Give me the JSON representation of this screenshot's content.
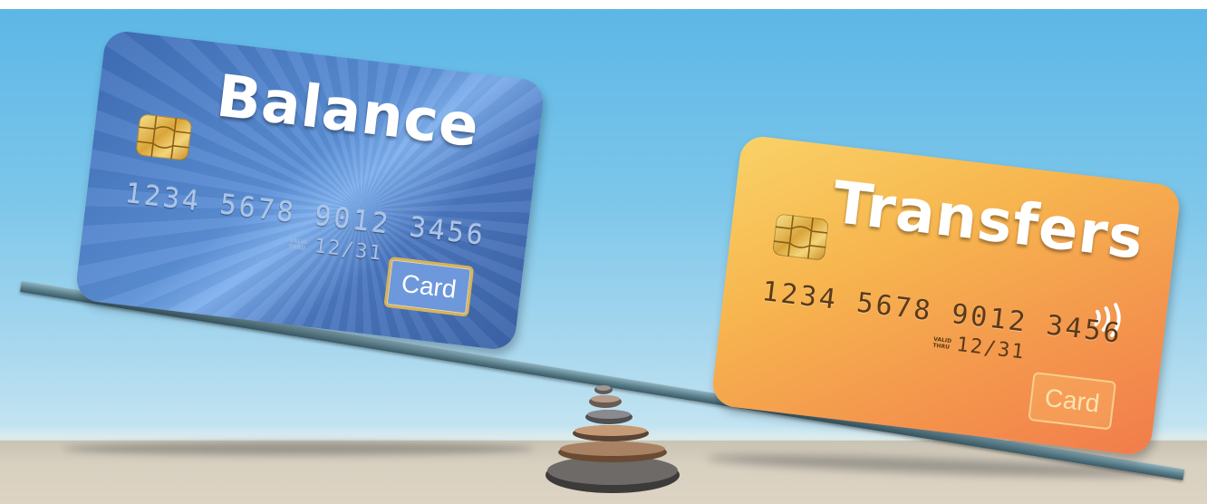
{
  "scene": {
    "colors": {
      "sky_top": "#5bb6e6",
      "sky_bottom": "#c7e6f2",
      "ground": "#d8d0c0",
      "plank": "#5a7f8c"
    }
  },
  "card_left": {
    "title": "Balance",
    "number": "1234 5678 9012 3456",
    "valid_label_1": "VALID",
    "valid_label_2": "THRU",
    "expiry": "12/31",
    "badge": "Card",
    "colors": {
      "base": "#4b77bf",
      "highlight": "#7fb0ee"
    },
    "icons": [
      "chip-icon"
    ]
  },
  "card_right": {
    "title": "Transfers",
    "number": "1234 5678 9012 3456",
    "valid_label_1": "VALID",
    "valid_label_2": "THRU",
    "expiry": "12/31",
    "badge": "Card",
    "colors": {
      "base": "#f7b64f",
      "accent": "#f27c4b"
    },
    "icons": [
      "chip-icon",
      "contactless-icon"
    ]
  }
}
